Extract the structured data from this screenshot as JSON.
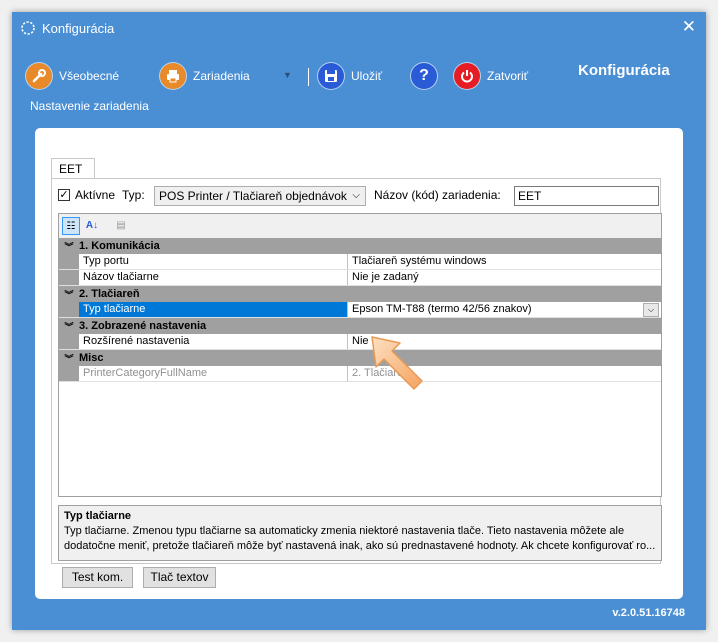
{
  "window": {
    "title": "Konfigurácia",
    "version": "v.2.0.51.16748"
  },
  "toolbar": {
    "general_label": "Všeobecné",
    "devices_label": "Zariadenia",
    "save_label": "Uložiť",
    "help_label": "?",
    "close_label": "Zatvoriť",
    "brand_title": "Konfigurácia",
    "subtitle": "Nastavenie zariadenia"
  },
  "tab": {
    "label": "EET"
  },
  "device": {
    "active_label": "Aktívne",
    "active_checked": true,
    "type_label": "Typ:",
    "type_value": "POS Printer / Tlačiareň objednávok",
    "name_label": "Názov (kód) zariadenia:",
    "name_value": "EET"
  },
  "propertygrid": {
    "categories": [
      {
        "name": "1. Komunikácia",
        "rows": [
          {
            "name": "Typ portu",
            "value": "Tlačiareň systému windows"
          },
          {
            "name": "Názov tlačiarne",
            "value": "Nie je zadaný"
          }
        ]
      },
      {
        "name": "2. Tlačiareň",
        "rows": [
          {
            "name": "Typ tlačiarne",
            "value": "Epson TM-T88 (termo 42/56 znakov)"
          }
        ]
      },
      {
        "name": "3. Zobrazené nastavenia",
        "rows": [
          {
            "name": "Rozšírené nastavenia",
            "value": "Nie"
          }
        ]
      },
      {
        "name": "Misc",
        "rows": [
          {
            "name": "PrinterCategoryFullName",
            "value": "2. Tlačiareň"
          }
        ]
      }
    ]
  },
  "help": {
    "title": "Typ tlačiarne",
    "text": "Typ tlačiarne. Zmenou typu tlačiarne sa automaticky zmenia niektoré nastavenia tlače. Tieto nastavenia môžete ale dodatočne meniť, pretože tlačiareň môže byť nastavená inak, ako sú prednastavené hodnoty. Ak chcete konfigurovať ro..."
  },
  "buttons": {
    "test_com": "Test kom.",
    "print_text": "Tlač textov"
  },
  "colors": {
    "window_bg": "#4a8fd4",
    "selection": "#0078d7",
    "category_bg": "#a0a0a0",
    "close_icon_red": "#e51c23",
    "help_icon_blue": "#2a5bd7",
    "tool_orange": "#e8892a"
  }
}
